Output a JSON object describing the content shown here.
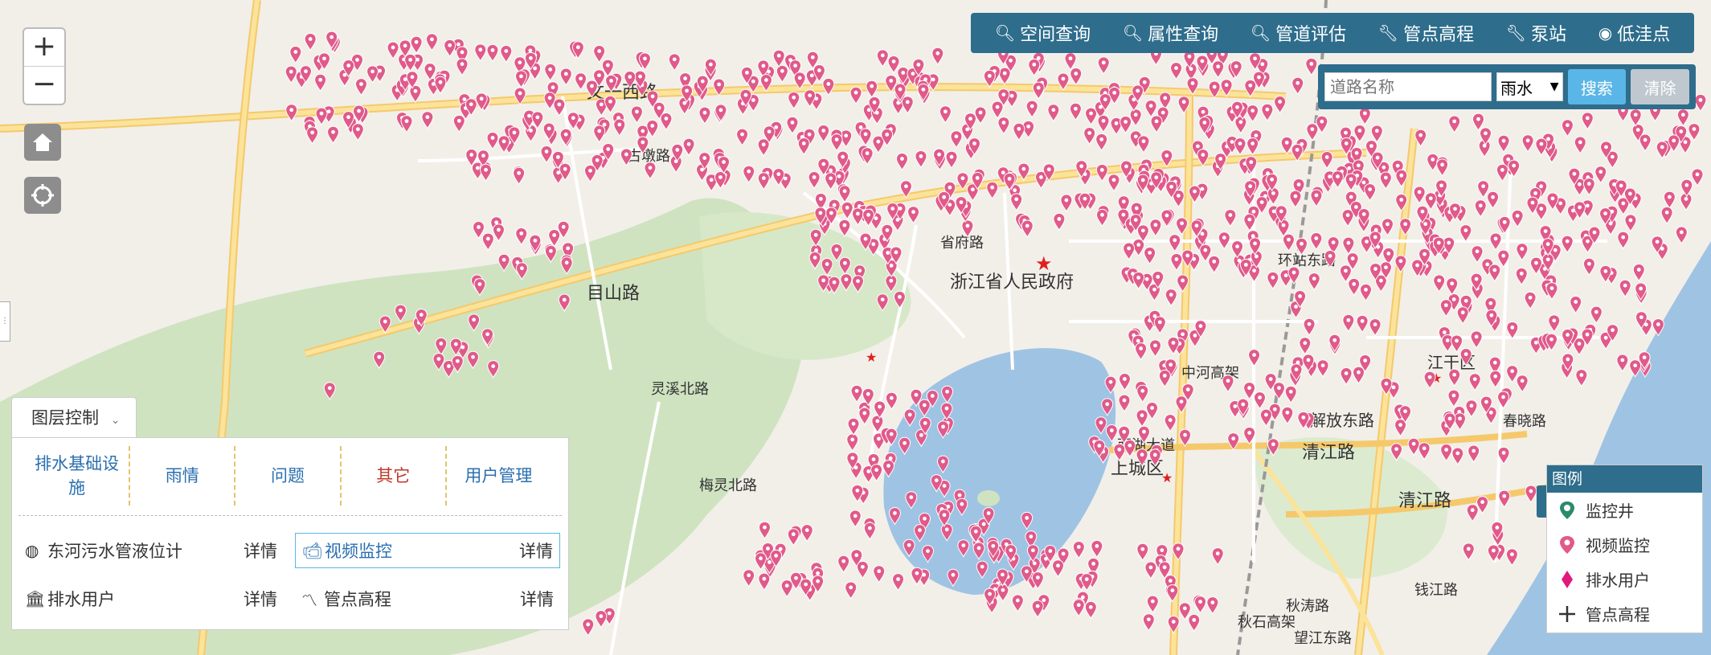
{
  "map": {
    "labels": {
      "road_wenyi": "文一西路",
      "road_tianmu": "目山路",
      "road_guduo": "古墩路",
      "road_shenghui": "省府路",
      "gov": "浙江省人民政府",
      "road_lingxi": "灵溪北路",
      "road_meiling": "梅灵北路",
      "road_zhonghe": "中河高架",
      "road_jiefang": "解放东路",
      "road_qingjiang1": "清江路",
      "road_qingjiang2": "清江路",
      "road_xihu": "西湖大道",
      "district": "上城区",
      "jianggan": "江干区",
      "road_qiushi": "秋石高架",
      "road_huanzhan": "环站东路",
      "road_qiutao": "秋涛路",
      "road_wangjiang": "望江东路",
      "road_qianjiang": "钱江路",
      "road_xiaoshan": "春晓路"
    },
    "marker_color": "#e05a8a"
  },
  "zoom": {
    "in": "+",
    "out": "−"
  },
  "toolbar": {
    "items": [
      {
        "icon": "search-icon",
        "label": "空间查询"
      },
      {
        "icon": "search-icon",
        "label": "属性查询"
      },
      {
        "icon": "search-icon",
        "label": "管道评估"
      },
      {
        "icon": "wrench-icon",
        "label": "管点高程"
      },
      {
        "icon": "wrench-icon",
        "label": "泵站"
      },
      {
        "icon": "target-icon",
        "label": "低洼点"
      }
    ]
  },
  "search": {
    "placeholder": "道路名称",
    "type_selected": "雨水",
    "search_label": "搜索",
    "clear_label": "清除"
  },
  "layers": {
    "title": "图层控制",
    "tabs": [
      "排水基础设施",
      "雨情",
      "问题",
      "其它",
      "用户管理"
    ],
    "rows": [
      {
        "label": "东河污水管液位计",
        "detail": "详情"
      },
      {
        "label": "视频监控",
        "detail": "详情"
      },
      {
        "label": "排水用户",
        "detail": "详情"
      },
      {
        "label": "管点高程",
        "detail": "详情"
      }
    ]
  },
  "legend": {
    "title": "图例",
    "items": [
      {
        "label": "监控井",
        "icon": "monitor-well-icon",
        "color": "#2b8a6e"
      },
      {
        "label": "视频监控",
        "icon": "video-marker-icon",
        "color": "#e05a8a"
      },
      {
        "label": "排水用户",
        "icon": "diamond-icon",
        "color": "#e0197d"
      },
      {
        "label": "管点高程",
        "icon": "plus-icon",
        "color": "#333333"
      }
    ]
  }
}
